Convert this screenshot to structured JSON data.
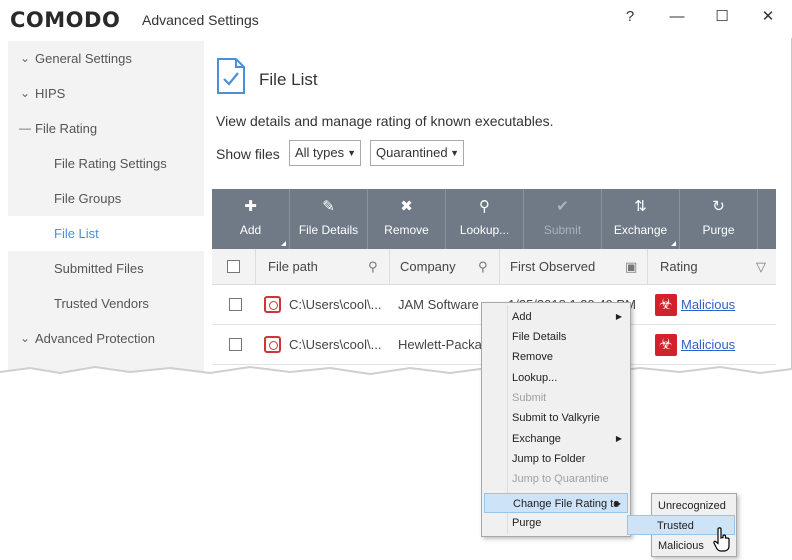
{
  "window": {
    "brand": "COMODO",
    "title": "Advanced Settings",
    "controls": [
      "?",
      "—",
      "☐",
      "✕"
    ]
  },
  "sidebar": {
    "items": [
      {
        "label": "General Settings",
        "expander": "chevron-down"
      },
      {
        "label": "HIPS",
        "expander": "chevron-down"
      },
      {
        "label": "File Rating",
        "expander": "collapse-dash"
      },
      {
        "label": "File Rating Settings"
      },
      {
        "label": "File Groups"
      },
      {
        "label": "File List",
        "active": true
      },
      {
        "label": "Submitted Files"
      },
      {
        "label": "Trusted Vendors"
      },
      {
        "label": "Advanced Protection",
        "expander": "chevron-down"
      }
    ]
  },
  "main": {
    "title": "File List",
    "description": "View details and manage rating of known executables.",
    "show_files_label": "Show files",
    "filter_type": "All types",
    "filter_status": "Quarantined",
    "toolbar": [
      {
        "label": "Add",
        "icon": "plus-icon"
      },
      {
        "label": "File Details",
        "icon": "pencil-icon"
      },
      {
        "label": "Remove",
        "icon": "x-icon"
      },
      {
        "label": "Lookup...",
        "icon": "search-icon"
      },
      {
        "label": "Submit",
        "icon": "check-icon",
        "disabled": true
      },
      {
        "label": "Exchange",
        "icon": "exchange-icon"
      },
      {
        "label": "Purge",
        "icon": "refresh-icon"
      }
    ],
    "columns": [
      "File path",
      "Company",
      "First Observed",
      "Rating"
    ],
    "rows": [
      {
        "path": "C:\\Users\\cool\\...",
        "company": "JAM Software",
        "first_observed": "1/25/2018 1:39:49 PM",
        "rating": "Malicious"
      },
      {
        "path": "C:\\Users\\cool\\...",
        "company": "Hewlett-Packa...",
        "first_observed": "",
        "rating": "Malicious"
      }
    ]
  },
  "context_menu": {
    "items": [
      {
        "label": "Add",
        "submenu": true
      },
      {
        "label": "File Details"
      },
      {
        "label": "Remove"
      },
      {
        "label": "Lookup..."
      },
      {
        "label": "Submit",
        "disabled": true
      },
      {
        "label": "Submit to Valkyrie"
      },
      {
        "label": "Exchange",
        "submenu": true
      },
      {
        "label": "Jump to Folder"
      },
      {
        "label": "Jump to Quarantine",
        "disabled": true
      },
      {
        "label": "Change File Rating to",
        "submenu": true,
        "highlighted": true
      },
      {
        "label": "Purge"
      }
    ],
    "rating_submenu": [
      "Unrecognized",
      "Trusted",
      "Malicious"
    ],
    "rating_submenu_highlighted": "Trusted"
  },
  "colors": {
    "accent": "#4a90d9",
    "toolbar_bg": "#6f7a86",
    "malicious": "#d3212b",
    "link": "#2c64c8"
  }
}
